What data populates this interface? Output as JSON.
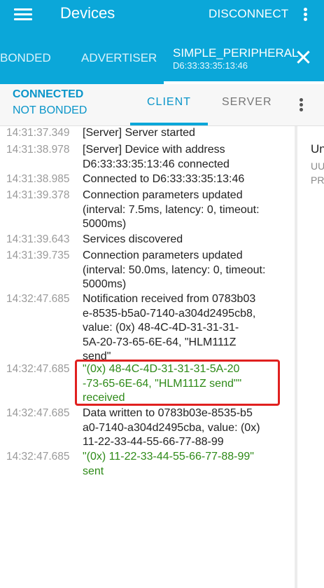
{
  "appbar": {
    "title": "Devices",
    "disconnect_label": "DISCONNECT",
    "menu_icon": "hamburger-menu-icon",
    "overflow_icon": "more-vert-icon"
  },
  "device_tabs": {
    "bonded": "BONDED",
    "advertiser": "ADVERTISER",
    "active_name": "SIMPLE_PERIPHERAL",
    "active_address": "D6:33:33:35:13:46",
    "close_icon": "close-icon"
  },
  "connection": {
    "state": "CONNECTED",
    "bond_state": "NOT BONDED"
  },
  "tabs": {
    "client": "CLIENT",
    "server": "SERVER"
  },
  "log": [
    {
      "time": "14:31:37.349",
      "lines": [
        "[Server] Server started"
      ],
      "color": "#222222"
    },
    {
      "time": "14:31:38.978",
      "lines": [
        "[Server] Device with address",
        "D6:33:33:35:13:46 connected"
      ],
      "color": "#222222"
    },
    {
      "time": "14:31:38.985",
      "lines": [
        "Connected to D6:33:33:35:13:46"
      ],
      "color": "#222222"
    },
    {
      "time": "14:31:39.378",
      "lines": [
        "Connection parameters updated",
        "(interval: 7.5ms, latency: 0, timeout:",
        "5000ms)"
      ],
      "color": "#222222"
    },
    {
      "time": "14:31:39.643",
      "lines": [
        "Services discovered"
      ],
      "color": "#222222"
    },
    {
      "time": "14:31:39.735",
      "lines": [
        "Connection parameters updated",
        "(interval: 50.0ms, latency: 0, timeout:",
        "5000ms)"
      ],
      "color": "#222222"
    },
    {
      "time": "14:32:47.685",
      "lines": [
        "Notification received from 0783b03",
        "e-8535-b5a0-7140-a304d2495cb8,",
        "value: (0x) 48-4C-4D-31-31-31-",
        "5A-20-73-65-6E-64, \"HLM111Z",
        "send\""
      ],
      "color": "#222222"
    },
    {
      "time": "14:32:47.685",
      "lines": [
        "\"(0x) 48-4C-4D-31-31-31-5A-20",
        "-73-65-6E-64, \"HLM111Z send\"\"",
        "received"
      ],
      "color": "#2e8a18"
    },
    {
      "time": "14:32:47.685",
      "lines": [
        "Data written to 0783b03e-8535-b5",
        "a0-7140-a304d2495cba, value: (0x)",
        "11-22-33-44-55-66-77-88-99"
      ],
      "color": "#222222"
    },
    {
      "time": "14:32:47.685",
      "lines": [
        "\"(0x) 11-22-33-44-55-66-77-88-99\"",
        "sent"
      ],
      "color": "#2e8a18"
    }
  ],
  "right_panel": {
    "title": "Un",
    "line1": "UU",
    "line2": "PR"
  },
  "colors": {
    "accent": "#0ba7d9",
    "highlight": "#e0201f",
    "success_text": "#2e8a18"
  }
}
